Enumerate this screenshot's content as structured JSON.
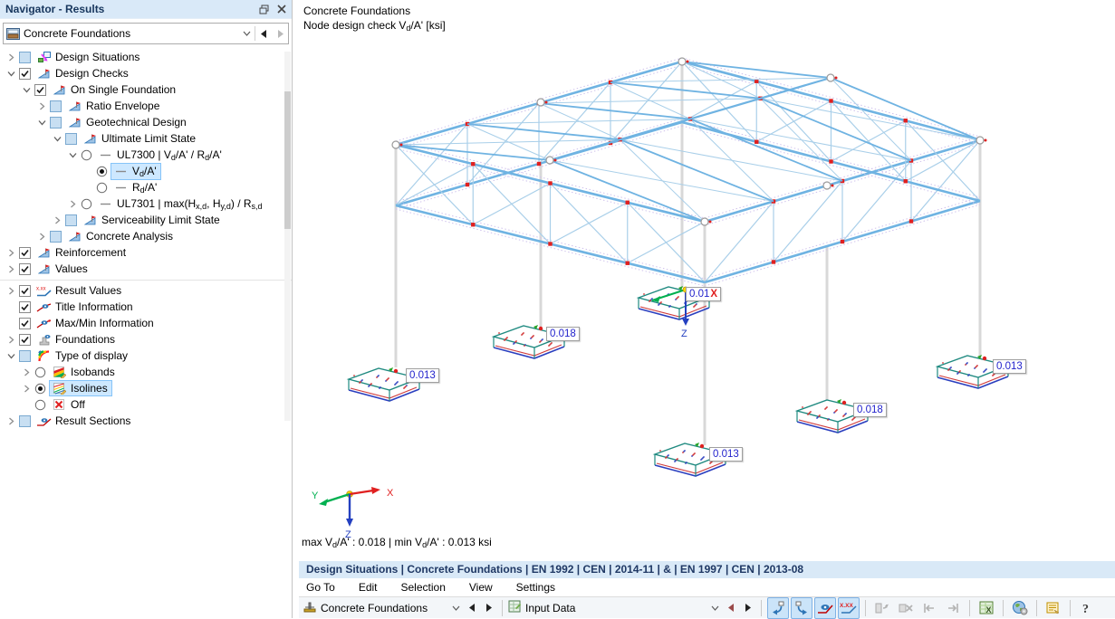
{
  "window": {
    "title": "Navigator - Results"
  },
  "navigator": {
    "combo_value": "Concrete Foundations",
    "tree": [
      {
        "level": 0,
        "exp": "right",
        "ctl": "partial",
        "icon": "design-situations",
        "label_html": "Design Situations"
      },
      {
        "level": 0,
        "exp": "down",
        "ctl": "checked",
        "icon": "design-check",
        "label_html": "Design Checks"
      },
      {
        "level": 1,
        "exp": "down",
        "ctl": "checked",
        "icon": "design-check",
        "label_html": "On Single Foundation"
      },
      {
        "level": 2,
        "exp": "right",
        "ctl": "partial",
        "icon": "design-check",
        "label_html": "Ratio Envelope"
      },
      {
        "level": 2,
        "exp": "down",
        "ctl": "partial",
        "icon": "design-check",
        "label_html": "Geotechnical Design"
      },
      {
        "level": 3,
        "exp": "down",
        "ctl": "partial",
        "icon": "design-check",
        "label_html": "Ultimate Limit State"
      },
      {
        "level": 4,
        "exp": "down",
        "ctl": "radio-off",
        "icon": "dash",
        "label_html": "UL7300 | V<sub>d</sub>/A' / R<sub>d</sub>/A'"
      },
      {
        "level": 5,
        "exp": null,
        "ctl": "radio-on",
        "icon": "dash",
        "label_html": "V<sub>d</sub>/A'",
        "selected": true
      },
      {
        "level": 5,
        "exp": null,
        "ctl": "radio-off",
        "icon": "dash",
        "label_html": "R<sub>d</sub>/A'"
      },
      {
        "level": 4,
        "exp": "right",
        "ctl": "radio-off",
        "icon": "dash",
        "label_html": "UL7301 | max(H<sub>x,d</sub>, H<sub>y,d</sub>) / R<sub>s,d</sub>"
      },
      {
        "level": 3,
        "exp": "right",
        "ctl": "partial",
        "icon": "design-check",
        "label_html": "Serviceability Limit State"
      },
      {
        "level": 2,
        "exp": "right",
        "ctl": "partial",
        "icon": "design-check",
        "label_html": "Concrete Analysis"
      },
      {
        "level": 0,
        "exp": "right",
        "ctl": "checked",
        "icon": "design-check",
        "label_html": "Reinforcement"
      },
      {
        "level": 0,
        "exp": "right",
        "ctl": "checked",
        "icon": "design-check",
        "label_html": "Values",
        "separator_after": true
      },
      {
        "level": 0,
        "exp": "right",
        "ctl": "checked",
        "icon": "result-values",
        "label_html": "Result Values"
      },
      {
        "level": 0,
        "exp": null,
        "ctl": "checked",
        "icon": "title-info",
        "label_html": "Title Information"
      },
      {
        "level": 0,
        "exp": null,
        "ctl": "checked",
        "icon": "maxmin-info",
        "label_html": "Max/Min Information"
      },
      {
        "level": 0,
        "exp": "right",
        "ctl": "checked",
        "icon": "foundations",
        "label_html": "Foundations"
      },
      {
        "level": 0,
        "exp": "down",
        "ctl": "partial",
        "icon": "rainbow",
        "label_html": "Type of display"
      },
      {
        "level": 1,
        "exp": "right",
        "ctl": "radio-off",
        "icon": "isobands",
        "label_html": "Isobands"
      },
      {
        "level": 1,
        "exp": "right",
        "ctl": "radio-on",
        "icon": "isolines",
        "label_html": "Isolines",
        "selected": true
      },
      {
        "level": 1,
        "exp": null,
        "ctl": "radio-off",
        "icon": "off",
        "label_html": "Off"
      },
      {
        "level": 0,
        "exp": "right",
        "ctl": "partial",
        "icon": "result-sections",
        "label_html": "Result Sections"
      }
    ]
  },
  "viewport": {
    "header_line1": "Concrete Foundations",
    "header_line2_html": "Node design check V<sub>d</sub>/A' [ksi]",
    "foundations": [
      {
        "value": "0.013"
      },
      {
        "value": "0.018"
      },
      {
        "value": "0.01",
        "axis_overlap": "X"
      },
      {
        "value": "0.013"
      },
      {
        "value": "0.018"
      },
      {
        "value": "0.013"
      }
    ],
    "axis_labels": {
      "x": "X",
      "y": "Y",
      "z": "Z"
    },
    "minmax_html": "max V<sub>d</sub>/A' : 0.018 | min V<sub>d</sub>/A' : 0.013 ksi"
  },
  "status_bar": {
    "text": "Design Situations | Concrete Foundations | EN 1992 | CEN | 2014-11 | & | EN 1997 | CEN | 2013-08"
  },
  "menu": {
    "items": [
      "Go To",
      "Edit",
      "Selection",
      "View",
      "Settings"
    ]
  },
  "bottom_toolbar": {
    "combo1": "Concrete Foundations",
    "combo2": "Input Data",
    "buttons": [
      {
        "name": "view-rotate-left",
        "state": "active"
      },
      {
        "name": "view-rotate-right",
        "state": "active"
      },
      {
        "name": "show-results",
        "state": "active"
      },
      {
        "name": "show-result-values",
        "state": "active"
      },
      {
        "name": "separator"
      },
      {
        "name": "block-copy",
        "state": "disabled"
      },
      {
        "name": "block-delete",
        "state": "disabled"
      },
      {
        "name": "jump-previous",
        "state": "disabled"
      },
      {
        "name": "jump-next",
        "state": "disabled"
      },
      {
        "name": "separator"
      },
      {
        "name": "excel-export",
        "state": "normal"
      },
      {
        "name": "separator"
      },
      {
        "name": "online-services",
        "state": "normal"
      },
      {
        "name": "separator"
      },
      {
        "name": "printout-report",
        "state": "normal"
      },
      {
        "name": "separator"
      },
      {
        "name": "help",
        "state": "normal"
      }
    ]
  },
  "colors": {
    "accent": "#2e75b6",
    "selection_bg": "#cde8ff",
    "status_bg": "#d9e9f7",
    "status_text": "#1f3864",
    "structure_blue": "#6fb3e2",
    "node_red": "#e02020",
    "foundation_teal": "#1f8a80",
    "value_text": "#2222cc"
  }
}
